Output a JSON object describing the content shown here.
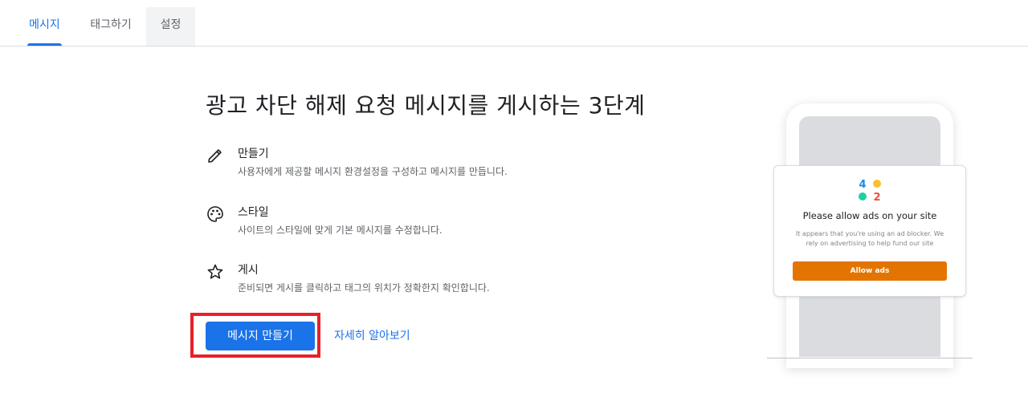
{
  "tabs": [
    {
      "label": "메시지",
      "active": true
    },
    {
      "label": "태그하기",
      "active": false
    },
    {
      "label": "설정",
      "active": false
    }
  ],
  "main": {
    "title": "광고 차단 해제 요청 메시지를 게시하는 3단계",
    "steps": [
      {
        "icon": "pencil-icon",
        "name": "만들기",
        "description": "사용자에게 제공할 메시지 환경설정을 구성하고 메시지를 만듭니다."
      },
      {
        "icon": "palette-icon",
        "name": "스타일",
        "description": "사이트의 스타일에 맞게 기본 메시지를 수정합니다."
      },
      {
        "icon": "star-icon",
        "name": "게시",
        "description": "준비되면 게시를 클릭하고 태그의 위치가 정확한지 확인합니다."
      }
    ],
    "create_button": "메시지 만들기",
    "learn_more_link": "자세히 알아보기"
  },
  "preview": {
    "logo_digits": [
      "4",
      "2"
    ],
    "card_title": "Please allow ads on your site",
    "card_body": "It appears that you're using an ad blocker. We rely on advertising to help fund our site",
    "allow_button": "Allow ads"
  },
  "colors": {
    "accent": "#1a73e8",
    "highlight": "#e8202a",
    "allow_button": "#e37400"
  }
}
